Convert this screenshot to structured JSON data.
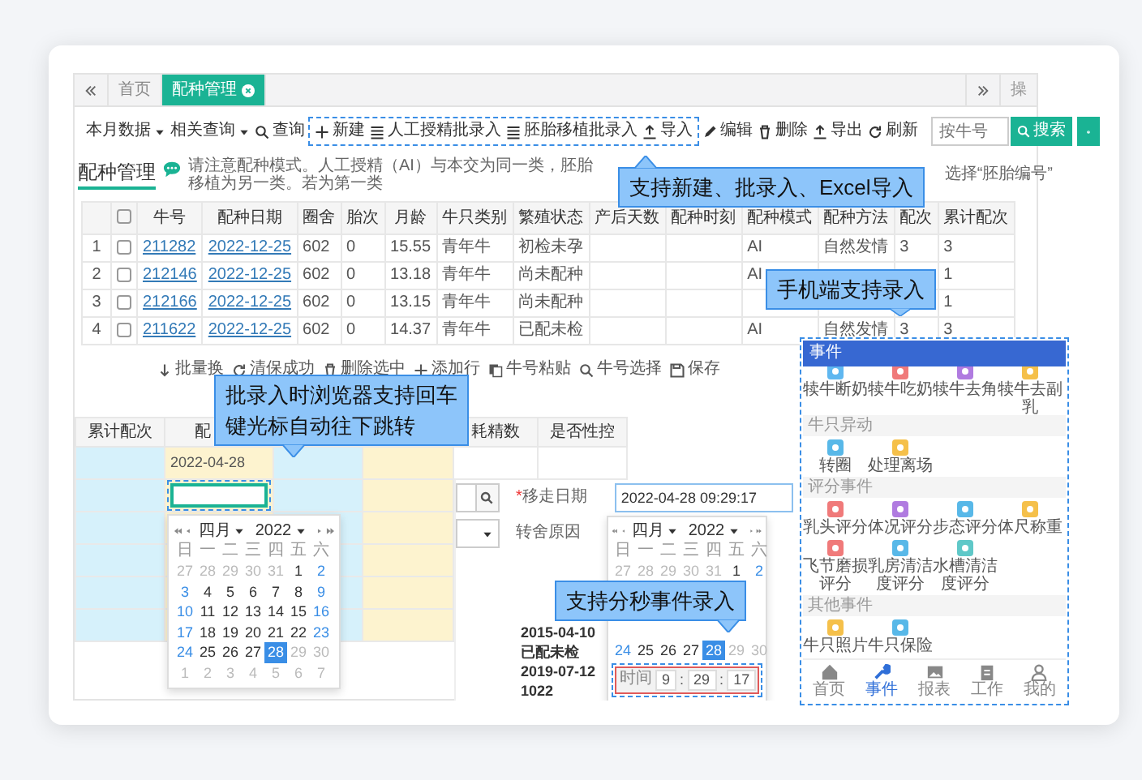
{
  "tabs": [
    {
      "label": "首页",
      "selected": false,
      "closable": false
    },
    {
      "label": "配种管理",
      "selected": true,
      "closable": true
    }
  ],
  "tab_overflow_label": "操",
  "toolbar": {
    "items": [
      {
        "label": "本月数据",
        "kind": "dropdown",
        "highlighted": false
      },
      {
        "label": "相关查询",
        "kind": "dropdown",
        "highlighted": false
      },
      {
        "label": "查询",
        "kind": "button",
        "highlighted": false
      },
      {
        "label": "新建",
        "kind": "button",
        "highlighted": true
      },
      {
        "label": "人工授精批录入",
        "kind": "button",
        "highlighted": true
      },
      {
        "label": "胚胎移植批录入",
        "kind": "button",
        "highlighted": true
      },
      {
        "label": "导入",
        "kind": "button",
        "highlighted": true
      },
      {
        "label": "编辑",
        "kind": "button",
        "highlighted": false
      },
      {
        "label": "删除",
        "kind": "button",
        "highlighted": false
      },
      {
        "label": "导出",
        "kind": "button",
        "highlighted": false
      },
      {
        "label": "刷新",
        "kind": "button",
        "highlighted": false
      }
    ],
    "search": {
      "placeholder": "按牛号",
      "button": "搜索"
    }
  },
  "page_title": "配种管理",
  "notice": "请注意配种模式。人工授精（AI）与本交为同一类，胚胎移植为另一类。若为第一类",
  "notice_tail": "选择“胚胎编号”",
  "table": {
    "all_checked": false,
    "columns": [
      {
        "label": "牛号",
        "kind": "link"
      },
      {
        "label": "配种日期",
        "kind": "link"
      },
      {
        "label": "圈舍",
        "kind": "text"
      },
      {
        "label": "胎次",
        "kind": "text"
      },
      {
        "label": "月龄",
        "kind": "text"
      },
      {
        "label": "牛只类别",
        "kind": "text"
      },
      {
        "label": "繁殖状态",
        "kind": "text"
      },
      {
        "label": "产后天数",
        "kind": "text"
      },
      {
        "label": "配种时刻",
        "kind": "text"
      },
      {
        "label": "配种模式",
        "kind": "text"
      },
      {
        "label": "配种方法",
        "kind": "text"
      },
      {
        "label": "配次",
        "kind": "text"
      },
      {
        "label": "累计配次",
        "kind": "text"
      }
    ],
    "rows": [
      {
        "index": "1",
        "checked": false,
        "cells": [
          "211282",
          "2022-12-25",
          "602",
          "0",
          "15.55",
          "青年牛",
          "初检未孕",
          "",
          "",
          "AI",
          "自然发情",
          "3",
          "3"
        ]
      },
      {
        "index": "2",
        "checked": false,
        "cells": [
          "212146",
          "2022-12-25",
          "602",
          "0",
          "13.18",
          "青年牛",
          "尚未配种",
          "",
          "",
          "AI",
          "",
          "",
          "1"
        ]
      },
      {
        "index": "3",
        "checked": false,
        "cells": [
          "212166",
          "2022-12-25",
          "602",
          "0",
          "13.15",
          "青年牛",
          "尚未配种",
          "",
          "",
          "",
          "",
          "",
          "1"
        ]
      },
      {
        "index": "4",
        "checked": false,
        "cells": [
          "211622",
          "2022-12-25",
          "602",
          "0",
          "14.37",
          "青年牛",
          "已配未检",
          "",
          "",
          "AI",
          "自然发情",
          "3",
          "3"
        ]
      }
    ]
  },
  "batch_toolbar": [
    "批量换",
    "清保成功",
    "删除选中",
    "添加行",
    "牛号粘贴",
    "牛号选择",
    "保存"
  ],
  "batch_grid": {
    "columns": [
      {
        "label": "累计配次",
        "color": "#d6f1fb"
      },
      {
        "label": "配",
        "color": "#fdf3cf"
      },
      {
        "color": "#d6f1fb"
      },
      {
        "color": "#fdf3cf"
      },
      {
        "label": "耗精数"
      },
      {
        "label": "是否性控"
      }
    ],
    "rows": [
      {
        "date": "2022-04-28",
        "editing": false
      },
      {
        "editing": true
      }
    ]
  },
  "date_picker": {
    "month": "四月",
    "year": "2022",
    "weekdays": [
      "日",
      "一",
      "二",
      "三",
      "四",
      "五",
      "六"
    ],
    "weeks": [
      [
        {
          "day": "27",
          "muted": true,
          "selected": false
        },
        {
          "day": "28",
          "muted": true,
          "selected": false
        },
        {
          "day": "29",
          "muted": true,
          "selected": false
        },
        {
          "day": "30",
          "muted": true,
          "selected": false
        },
        {
          "day": "31",
          "muted": true,
          "selected": false
        },
        {
          "day": "1",
          "muted": false,
          "selected": false
        },
        {
          "day": "2",
          "muted": false,
          "selected": false
        }
      ],
      [
        {
          "day": "3",
          "muted": false,
          "selected": false
        },
        {
          "day": "4",
          "muted": false,
          "selected": false
        },
        {
          "day": "5",
          "muted": false,
          "selected": false
        },
        {
          "day": "6",
          "muted": false,
          "selected": false
        },
        {
          "day": "7",
          "muted": false,
          "selected": false
        },
        {
          "day": "8",
          "muted": false,
          "selected": false
        },
        {
          "day": "9",
          "muted": false,
          "selected": false
        }
      ],
      [
        {
          "day": "10",
          "muted": false,
          "selected": false
        },
        {
          "day": "11",
          "muted": false,
          "selected": false
        },
        {
          "day": "12",
          "muted": false,
          "selected": false
        },
        {
          "day": "13",
          "muted": false,
          "selected": false
        },
        {
          "day": "14",
          "muted": false,
          "selected": false
        },
        {
          "day": "15",
          "muted": false,
          "selected": false
        },
        {
          "day": "16",
          "muted": false,
          "selected": false
        }
      ],
      [
        {
          "day": "17",
          "muted": false,
          "selected": false
        },
        {
          "day": "18",
          "muted": false,
          "selected": false
        },
        {
          "day": "19",
          "muted": false,
          "selected": false
        },
        {
          "day": "20",
          "muted": false,
          "selected": false
        },
        {
          "day": "21",
          "muted": false,
          "selected": false
        },
        {
          "day": "22",
          "muted": false,
          "selected": false
        },
        {
          "day": "23",
          "muted": false,
          "selected": false
        }
      ],
      [
        {
          "day": "24",
          "muted": false,
          "selected": false
        },
        {
          "day": "25",
          "muted": false,
          "selected": false
        },
        {
          "day": "26",
          "muted": false,
          "selected": false
        },
        {
          "day": "27",
          "muted": false,
          "selected": false
        },
        {
          "day": "28",
          "muted": false,
          "selected": true
        },
        {
          "day": "29",
          "muted": true,
          "selected": false
        },
        {
          "day": "30",
          "muted": true,
          "selected": false
        }
      ],
      [
        {
          "day": "1",
          "muted": true,
          "selected": false
        },
        {
          "day": "2",
          "muted": true,
          "selected": false
        },
        {
          "day": "3",
          "muted": true,
          "selected": false
        },
        {
          "day": "4",
          "muted": true,
          "selected": false
        },
        {
          "day": "5",
          "muted": true,
          "selected": false
        },
        {
          "day": "6",
          "muted": true,
          "selected": false
        },
        {
          "day": "7",
          "muted": true,
          "selected": false
        }
      ]
    ]
  },
  "event_form": {
    "date_mark": "*",
    "date_label": "移走日期",
    "date_value": "2022-04-28 09:29:17",
    "reason_label": "转舍原因",
    "list": [
      "2015-04-10",
      "已配未检",
      "2019-07-12",
      "1022"
    ],
    "picker": {
      "month": "四月",
      "year": "2022",
      "weekdays": [
        "日",
        "一",
        "二",
        "三",
        "四",
        "五",
        "六"
      ],
      "weeks": [
        [
          {
            "day": "27",
            "muted": true,
            "selected": false
          },
          {
            "day": "28",
            "muted": true,
            "selected": false
          },
          {
            "day": "29",
            "muted": true,
            "selected": false
          },
          {
            "day": "30",
            "muted": true,
            "selected": false
          },
          {
            "day": "31",
            "muted": true,
            "selected": false
          },
          {
            "day": "1",
            "muted": false,
            "selected": false
          },
          {
            "day": "2",
            "muted": false,
            "selected": false
          }
        ],
        [
          {
            "day": "24",
            "muted": false,
            "selected": false
          },
          {
            "day": "25",
            "muted": false,
            "selected": false
          },
          {
            "day": "26",
            "muted": false,
            "selected": false
          },
          {
            "day": "27",
            "muted": false,
            "selected": false
          },
          {
            "day": "28",
            "muted": false,
            "selected": true
          },
          {
            "day": "29",
            "muted": true,
            "selected": false
          },
          {
            "day": "30",
            "muted": true,
            "selected": false
          }
        ]
      ],
      "time": {
        "label": "时间",
        "separator": ":",
        "hour": "9",
        "minute": "29",
        "second": "17"
      }
    }
  },
  "mobile": {
    "title": "事件",
    "sections": [
      {
        "items": [
          "犊牛断奶",
          "犊牛吃奶",
          "犊牛去角",
          "犊牛去副乳"
        ]
      },
      {
        "title": "牛只异动",
        "items": [
          "转圈",
          "处理离场"
        ]
      },
      {
        "title": "评分事件",
        "items": [
          "乳头评分",
          "体况评分",
          "步态评分",
          "体尺称重",
          "飞节磨损评分",
          "乳房清洁度评分",
          "水槽清洁度评分"
        ]
      },
      {
        "title": "其他事件",
        "items": [
          "牛只照片",
          "牛只保险"
        ]
      }
    ],
    "nav": [
      {
        "label": "首页",
        "selected": false
      },
      {
        "label": "事件",
        "selected": true
      },
      {
        "label": "报表",
        "selected": false
      },
      {
        "label": "工作",
        "selected": false
      },
      {
        "label": "我的",
        "selected": false
      }
    ]
  },
  "callouts": [
    {
      "lines": [
        "支持新建、批录入、Excel导入"
      ]
    },
    {
      "lines": [
        "手机端支持录入"
      ]
    },
    {
      "lines": [
        "批录入时浏览器支持回车",
        "键光标自动往下跳转"
      ]
    },
    {
      "lines": [
        "支持分秒事件录入"
      ]
    }
  ]
}
